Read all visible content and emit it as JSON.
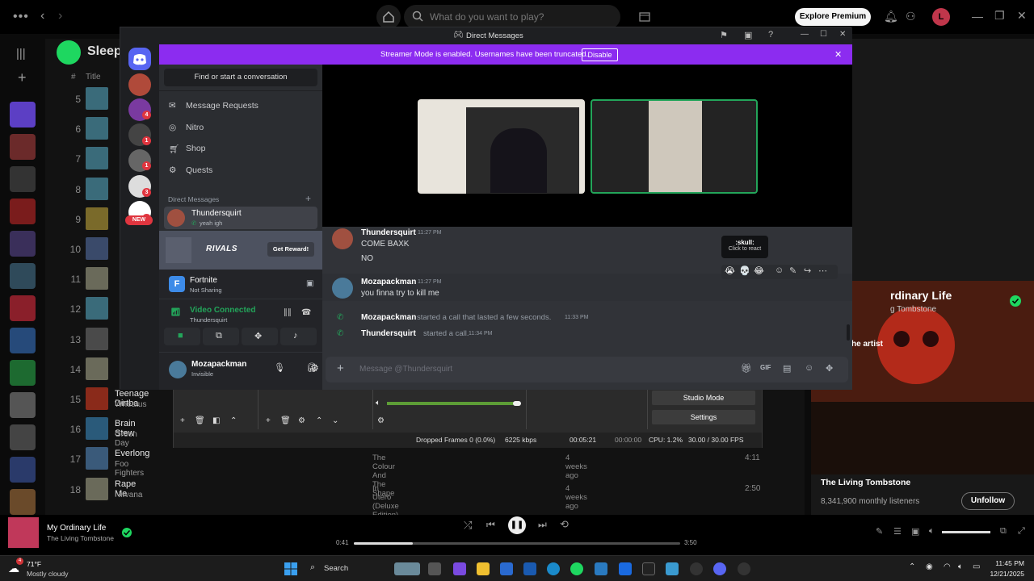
{
  "spotify": {
    "search_placeholder": "What do you want to play?",
    "explore_label": "Explore Premium",
    "avatar_letter": "L",
    "playlist_title": "Sleep",
    "col_hash": "#",
    "col_title": "Title",
    "tracks": [
      {
        "num": "5",
        "title": "",
        "artist": "",
        "album": "",
        "date": "",
        "len": ""
      },
      {
        "num": "6",
        "title": "",
        "artist": "",
        "album": "",
        "date": "",
        "len": ""
      },
      {
        "num": "7",
        "title": "",
        "artist": "",
        "album": "",
        "date": "",
        "len": ""
      },
      {
        "num": "8",
        "title": "",
        "artist": "",
        "album": "",
        "date": "",
        "len": ""
      },
      {
        "num": "9",
        "title": "",
        "artist": "",
        "album": "",
        "date": "",
        "len": ""
      },
      {
        "num": "10",
        "title": "",
        "artist": "",
        "album": "",
        "date": "",
        "len": ""
      },
      {
        "num": "11",
        "title": "",
        "artist": "",
        "album": "",
        "date": "",
        "len": ""
      },
      {
        "num": "12",
        "title": "",
        "artist": "",
        "album": "",
        "date": "",
        "len": ""
      },
      {
        "num": "13",
        "title": "",
        "artist": "",
        "album": "",
        "date": "",
        "len": ""
      },
      {
        "num": "14",
        "title": "",
        "artist": "",
        "album": "",
        "date": "",
        "len": ""
      },
      {
        "num": "15",
        "title": "Teenage Dirtba",
        "artist": "Wheatus",
        "album": "",
        "date": "",
        "len": ""
      },
      {
        "num": "16",
        "title": "Brain Stew",
        "artist": "Green Day",
        "album": "",
        "date": "",
        "len": ""
      },
      {
        "num": "17",
        "title": "Everlong",
        "artist": "Foo Fighters",
        "album": "The Colour And The Shape",
        "date": "4 weeks ago",
        "len": "4:11"
      },
      {
        "num": "18",
        "title": "Rape Me",
        "artist": "Nirvana",
        "album": "In Utero (Deluxe Edition)",
        "date": "4 weeks ago",
        "len": "2:50"
      }
    ],
    "right_panel": {
      "song_title": "rdinary Life",
      "artist_line": "g Tombstone",
      "about_label": "he artist",
      "artist_name": "The Living Tombstone",
      "listeners": "8,341,900 monthly listeners",
      "unfollow": "Unfollow"
    },
    "player": {
      "song": "My Ordinary Life",
      "artist": "The Living Tombstone",
      "elapsed": "0:41",
      "total": "3:50",
      "progress": 0.18
    }
  },
  "taskbar": {
    "temp": "71°F",
    "weather": "Mostly cloudy",
    "search": "Search",
    "time": "11:45 PM",
    "date": "12/21/2025",
    "weather_badge": "4"
  },
  "obs": {
    "studio_mode": "Studio Mode",
    "settings": "Settings",
    "dropped_frames": "Dropped Frames 0 (0.0%)",
    "bitrate": "6225 kbps",
    "stream_time": "00:05:21",
    "rec_time": "00:00:00",
    "cpu": "CPU: 1.2%",
    "fps": "30.00 / 30.00 FPS"
  },
  "discord": {
    "window_title": "Direct Messages",
    "streamer_banner": "Streamer Mode is enabled. Usernames have been truncated.",
    "disable_label": "Disable",
    "find_conversation": "Find or start a conversation",
    "nav": [
      "Message Requests",
      "Nitro",
      "Shop",
      "Quests"
    ],
    "dm_header": "Direct Messages",
    "dm_user": {
      "name": "Thundersquirt",
      "status": "yeah igh"
    },
    "new_badge": "NEW",
    "rivals_logo": "RIVALS",
    "get_reward": "Get Reward!",
    "activity": {
      "game": "Fortnite",
      "status": "Not Sharing"
    },
    "voice": {
      "status": "Video Connected",
      "channel": "Thundersquirt"
    },
    "self": {
      "name": "Mozapackman",
      "status": "Invisible"
    },
    "server_badges": [
      "4",
      "1",
      "1",
      "3",
      "1"
    ],
    "messages": [
      {
        "author": "Thundersquirt",
        "time": "11:27 PM",
        "lines": [
          "COME BAXK",
          "NO"
        ]
      },
      {
        "author": "Mozapackman",
        "time": "11:27 PM",
        "lines": [
          "you finna try to kill me"
        ]
      }
    ],
    "calls": [
      {
        "author": "Mozapackman",
        "text": "started a call that lasted a few seconds.",
        "time": "11:33 PM"
      },
      {
        "author": "Thundersquirt",
        "text": "started a call.",
        "time": "11:34 PM"
      }
    ],
    "tooltip": {
      "title": ":skull:",
      "sub": "Click to react"
    },
    "input_placeholder": "Message @Thundersquirt"
  },
  "colors": {
    "discord_blurple": "#5865f2",
    "streamer_purple": "#8c2cf0",
    "spotify_green": "#1ed760",
    "voice_green": "#23a55a"
  }
}
